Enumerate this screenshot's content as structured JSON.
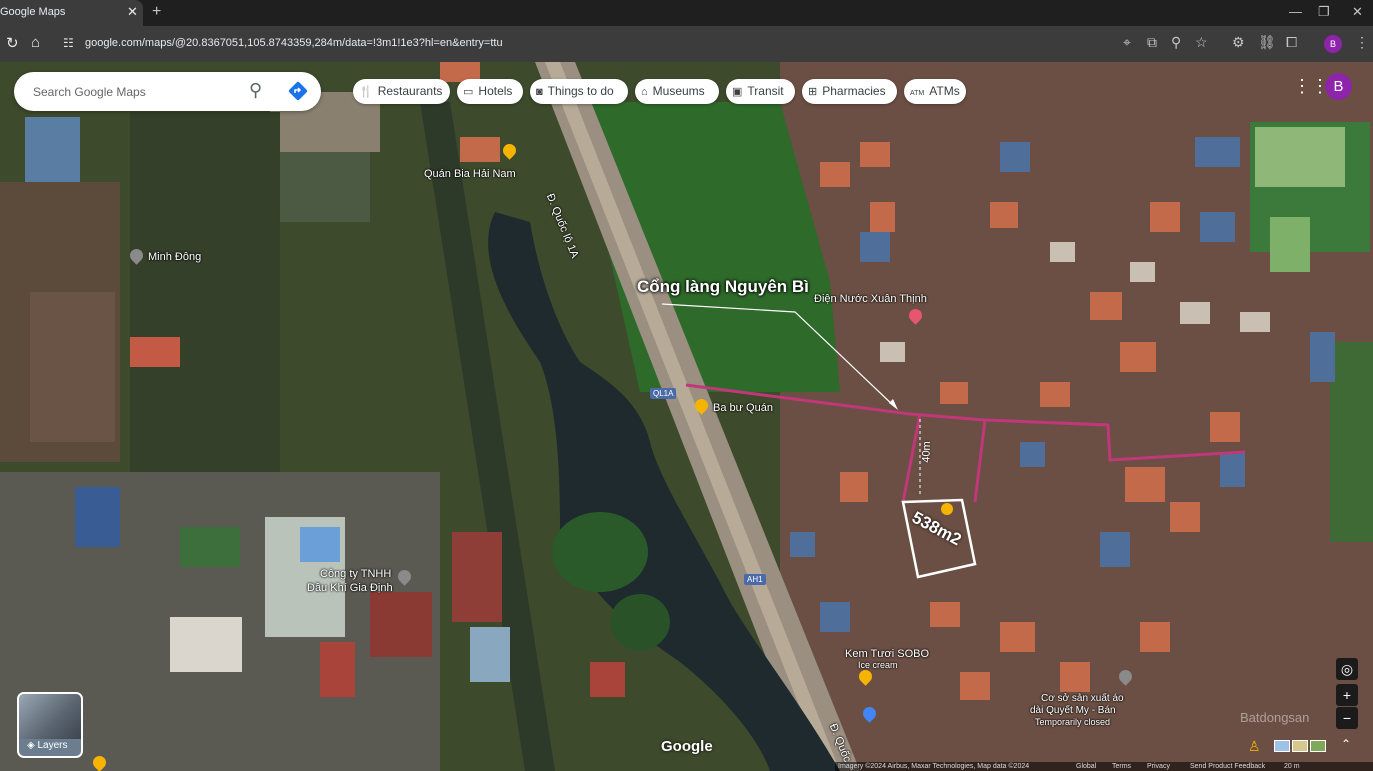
{
  "browser": {
    "tab_title": "Google Maps",
    "tab_close": "✕",
    "new_tab": "+",
    "window_min": "—",
    "window_max": "❐",
    "window_close": "✕",
    "url": "google.com/maps/@20.8367051,105.8743359,284m/data=!3m1!1e3?hl=en&entry=ttu",
    "profile_initial": "B"
  },
  "search": {
    "placeholder": "Search Google Maps"
  },
  "chips": [
    {
      "label": "Restaurants",
      "icon": "fork-knife-icon"
    },
    {
      "label": "Hotels",
      "icon": "bed-icon"
    },
    {
      "label": "Things to do",
      "icon": "camera-icon"
    },
    {
      "label": "Museums",
      "icon": "museum-icon"
    },
    {
      "label": "Transit",
      "icon": "bus-icon"
    },
    {
      "label": "Pharmacies",
      "icon": "pharmacy-icon"
    },
    {
      "label": "ATMs",
      "icon": "atm-icon"
    }
  ],
  "account_initial": "B",
  "places": {
    "bia": "Quán Bia Hải Nam",
    "minh_dong": "Minh Đông",
    "ba_bu": "Ba bư Quán",
    "dien_nuoc": "Điện Nước Xuân Thịnh",
    "congty1": "Công ty TNHH",
    "congty2": "Dầu Khí Gia Định",
    "kem1": "Kem Tươi SOBO",
    "kem2": "Ice cream",
    "coso1": "Cơ sở sản xuất áo",
    "coso2": "dài Quyết My - Bán",
    "coso3": "Temporarily closed"
  },
  "roads": {
    "quoc_lo": "Đ. Quốc lộ 1A",
    "quoc_bottom": "Đ. Quốc",
    "ql1a": "QL1A",
    "ah1": "AH1"
  },
  "annotations": {
    "gate_label": "Cổng làng Nguyên Bì",
    "distance": "40m",
    "area": "538m2"
  },
  "map_ui": {
    "layers": "Layers",
    "google_logo": "Google",
    "zoom_in": "+",
    "zoom_out": "−",
    "expand": "⌃",
    "watermark": "Batdongsan",
    "footer_imagery": "Imagery ©2024 Airbus, Maxar Technologies, Map data ©2024",
    "footer_global": "Global",
    "footer_terms": "Terms",
    "footer_privacy": "Privacy",
    "footer_feedback": "Send Product Feedback",
    "footer_scale": "20 m"
  },
  "colors": {
    "route": "#c0387a",
    "accent": "#8e24aa",
    "water": "#1e2a2d"
  }
}
